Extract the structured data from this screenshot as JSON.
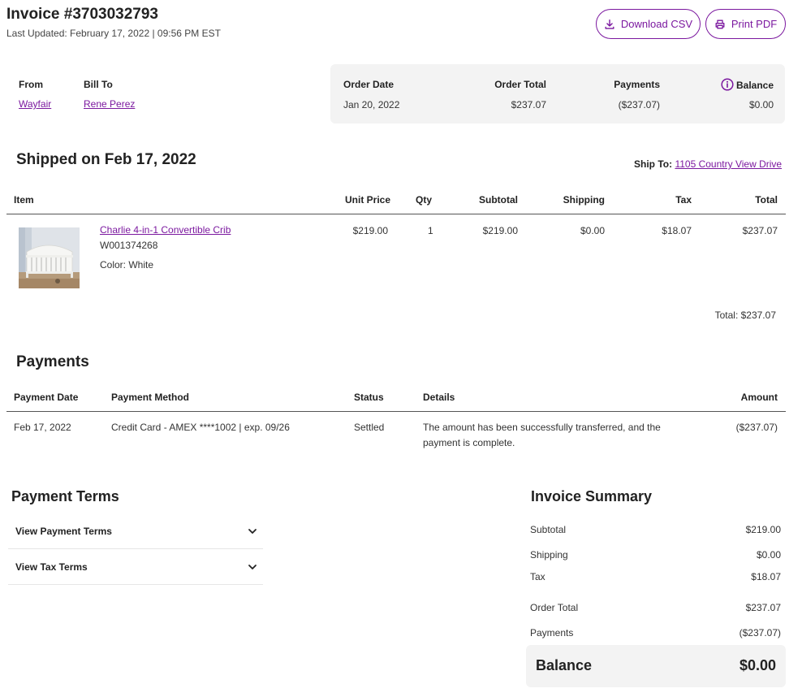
{
  "header": {
    "title": "Invoice #3703032793",
    "last_updated": "Last Updated: February 17, 2022 | 09:56 PM EST",
    "download_csv": "Download CSV",
    "print_pdf": "Print PDF"
  },
  "parties": {
    "from_label": "From",
    "from_value": "Wayfair",
    "bill_to_label": "Bill To",
    "bill_to_value": "Rene Perez"
  },
  "order_summary": {
    "order_date_label": "Order Date",
    "order_date_value": "Jan 20, 2022",
    "order_total_label": "Order Total",
    "order_total_value": "$237.07",
    "payments_label": "Payments",
    "payments_value": "($237.07)",
    "balance_label": "Balance",
    "balance_value": "$0.00"
  },
  "shipment": {
    "heading": "Shipped on Feb 17, 2022",
    "ship_to_label": "Ship To:",
    "ship_to_value": "1105 Country View Drive",
    "columns": [
      "Item",
      "Unit Price",
      "Qty",
      "Subtotal",
      "Shipping",
      "Tax",
      "Total"
    ],
    "item": {
      "name": "Charlie 4-in-1 Convertible Crib",
      "sku": "W001374268",
      "color": "Color: White",
      "unit_price": "$219.00",
      "qty": "1",
      "subtotal": "$219.00",
      "shipping": "$0.00",
      "tax": "$18.07",
      "total": "$237.07"
    },
    "total_line": "Total: $237.07"
  },
  "payments": {
    "heading": "Payments",
    "columns": [
      "Payment Date",
      "Payment Method",
      "Status",
      "Details",
      "Amount"
    ],
    "row": {
      "date": "Feb 17, 2022",
      "method": "Credit Card - AMEX ****1002 | exp. 09/26",
      "status": "Settled",
      "details_line1": "The amount has been successfully transferred, and the",
      "details_line2": "payment is complete.",
      "amount": "($237.07)"
    }
  },
  "payment_terms": {
    "heading": "Payment Terms",
    "items": [
      "View Payment Terms",
      "View Tax Terms"
    ]
  },
  "invoice_summary": {
    "heading": "Invoice Summary",
    "rows": [
      {
        "label": "Subtotal",
        "value": "$219.00"
      },
      {
        "label": "Shipping",
        "value": "$0.00"
      },
      {
        "label": "Tax",
        "value": "$18.07"
      },
      {
        "label": "Order Total",
        "value": "$237.07"
      },
      {
        "label": "Payments",
        "value": "($237.07)"
      }
    ],
    "balance_label": "Balance",
    "balance_value": "$0.00"
  },
  "colors": {
    "accent": "#7b189f",
    "panel": "#f3f3f3"
  }
}
